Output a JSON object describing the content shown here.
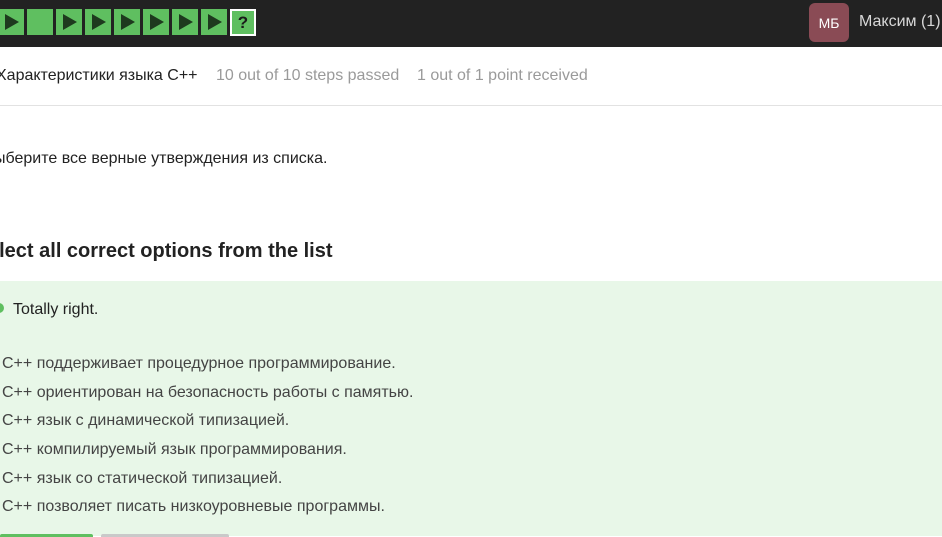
{
  "topbar": {
    "steps": [
      {
        "icon": "play-icon",
        "status": "passed"
      },
      {
        "icon": "square-icon",
        "status": "passed"
      },
      {
        "icon": "play-icon",
        "status": "passed"
      },
      {
        "icon": "play-icon",
        "status": "passed"
      },
      {
        "icon": "play-icon",
        "status": "passed"
      },
      {
        "icon": "play-icon",
        "status": "passed"
      },
      {
        "icon": "play-icon",
        "status": "passed"
      },
      {
        "icon": "play-icon",
        "status": "passed"
      },
      {
        "icon": "question-icon",
        "status": "current",
        "label": "?"
      }
    ],
    "user": {
      "initials": "МБ",
      "name": "Максим (1)"
    }
  },
  "lesson": {
    "title": "Характеристики языка C++",
    "steps_passed": "10 out of 10 steps passed",
    "points": "1 out of 1 point  received"
  },
  "question": {
    "ru": "ыберите все верные утверждения из списка.",
    "en": "elect all correct options from the list"
  },
  "feedback": {
    "text": "Totally right.",
    "options": [
      "C++ поддерживает процедурное программирование.",
      "C++ ориентирован на безопасность работы с памятью.",
      "C++ язык с динамической типизацией.",
      "C++ компилируемый язык программирования.",
      "C++ язык со статической типизацией.",
      "C++ позволяет писать низкоуровневые программы."
    ]
  },
  "colors": {
    "accent": "#5fbf60",
    "topbar": "#222222",
    "avatar": "#8a4b55",
    "feedback_bg": "#e8f7e8"
  }
}
